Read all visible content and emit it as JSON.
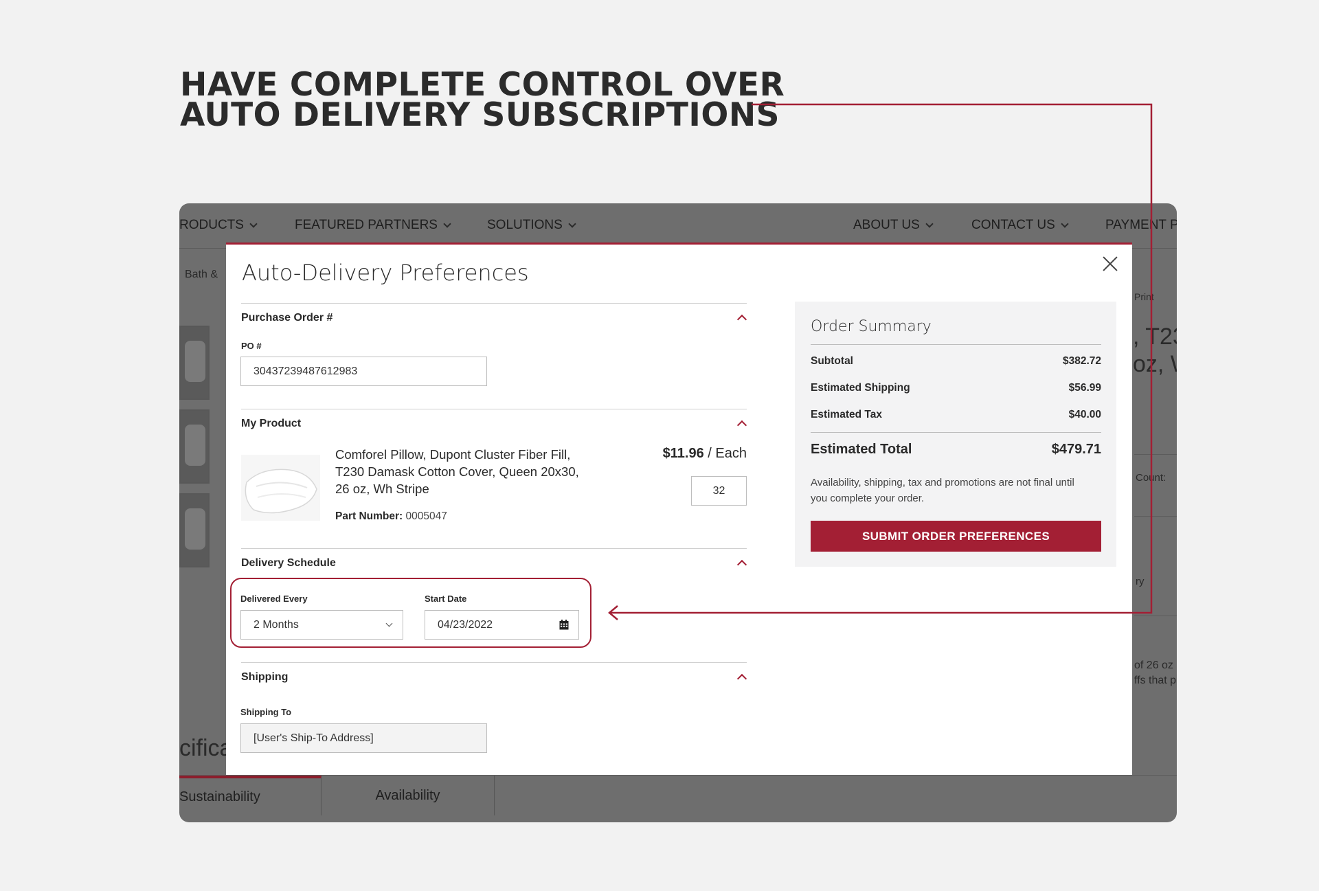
{
  "headline": {
    "line1": "HAVE COMPLETE CONTROL OVER",
    "line2": "AUTO DELIVERY SUBSCRIPTIONS"
  },
  "background": {
    "nav": [
      "RODUCTS",
      "FEATURED PARTNERS",
      "SOLUTIONS",
      "ABOUT US",
      "CONTACT US",
      "PAYMENT P"
    ],
    "breadcrumb": "Bath &",
    "print_link": "Print",
    "title_fragment_1": ", T23",
    "title_fragment_2": "oz, W",
    "count_label": "Count:",
    "ry_fragment": "ry",
    "desc_fragment_1": "of 26 oz",
    "desc_fragment_2": "ffs that p",
    "specs_fragment": "cifica",
    "tabs": [
      "Sustainability",
      "Availability"
    ]
  },
  "modal": {
    "title": "Auto-Delivery Preferences",
    "purchase_order": {
      "heading": "Purchase Order #",
      "label": "PO #",
      "value": "30437239487612983"
    },
    "product": {
      "heading": "My Product",
      "name": "Comforel Pillow, Dupont Cluster Fiber Fill, T230 Damask Cotton Cover, Queen 20x30, 26 oz, Wh Stripe",
      "part_label": "Part Number:",
      "part_number": "0005047",
      "price": "$11.96",
      "unit": "/ Each",
      "quantity": "32"
    },
    "delivery": {
      "heading": "Delivery Schedule",
      "every_label": "Delivered Every",
      "every_value": "2 Months",
      "start_label": "Start Date",
      "start_value": "04/23/2022"
    },
    "shipping": {
      "heading": "Shipping",
      "label": "Shipping To",
      "value": "[User's Ship-To Address]"
    }
  },
  "summary": {
    "title": "Order Summary",
    "rows": [
      {
        "label": "Subtotal",
        "value": "$382.72"
      },
      {
        "label": "Estimated Shipping",
        "value": "$56.99"
      },
      {
        "label": "Estimated Tax",
        "value": "$40.00"
      }
    ],
    "total_label": "Estimated Total",
    "total_value": "$479.71",
    "note": "Availability, shipping, tax and promotions are not final until you complete your order.",
    "submit": "SUBMIT ORDER PREFERENCES"
  },
  "colors": {
    "accent": "#a31f34",
    "overlay": "#6e6e6e",
    "page_bg": "#f2f2f2"
  }
}
